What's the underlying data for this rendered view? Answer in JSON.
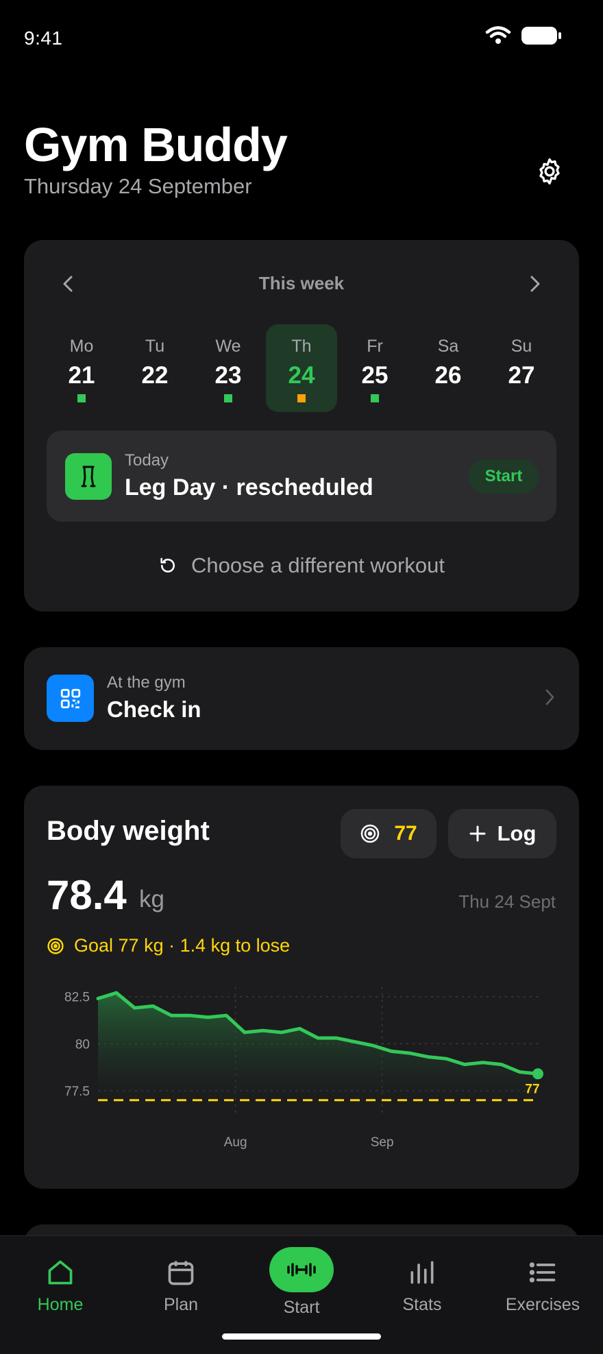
{
  "status": {
    "time": "9:41"
  },
  "header": {
    "title": "Gym Buddy",
    "date": "Thursday 24 September"
  },
  "week": {
    "title": "This week",
    "days": [
      {
        "name": "Mo",
        "num": "21",
        "dot": "#34c759"
      },
      {
        "name": "Tu",
        "num": "22",
        "dot": ""
      },
      {
        "name": "We",
        "num": "23",
        "dot": "#34c759"
      },
      {
        "name": "Th",
        "num": "24",
        "dot": "#ff9f0a",
        "selected": true
      },
      {
        "name": "Fr",
        "num": "25",
        "dot": "#34c759"
      },
      {
        "name": "Sa",
        "num": "26",
        "dot": ""
      },
      {
        "name": "Su",
        "num": "27",
        "dot": ""
      }
    ],
    "today": {
      "label": "Today",
      "title": "Leg Day · rescheduled",
      "start_label": "Start"
    },
    "choose_label": "Choose a different workout"
  },
  "checkin": {
    "label": "At the gym",
    "title": "Check in"
  },
  "weight": {
    "title": "Body weight",
    "goal_button_value": "77",
    "log_label": "Log",
    "value": "78.4",
    "unit": "kg",
    "date": "Thu 24 Sept",
    "goal_text": "Goal 77 kg · 1.4 kg to lose"
  },
  "chart_data": {
    "type": "area",
    "y_ticks": [
      "82.5",
      "80",
      "77.5"
    ],
    "x_ticks": [
      "Aug",
      "Sep"
    ],
    "ylim": [
      77.1,
      83.0
    ],
    "goal": 77,
    "goal_label": "77",
    "values": [
      82.4,
      82.7,
      81.9,
      82.0,
      81.5,
      81.5,
      81.4,
      81.5,
      80.6,
      80.7,
      80.6,
      80.8,
      80.3,
      80.3,
      80.1,
      79.9,
      79.6,
      79.5,
      79.3,
      79.2,
      78.9,
      79.0,
      78.9,
      78.5,
      78.4
    ],
    "grid": true,
    "colors": {
      "line": "#34c759",
      "goal": "#ffd60a"
    }
  },
  "tabs": [
    {
      "label": "Home",
      "active": true
    },
    {
      "label": "Plan"
    },
    {
      "label": "Start"
    },
    {
      "label": "Stats"
    },
    {
      "label": "Exercises"
    }
  ]
}
